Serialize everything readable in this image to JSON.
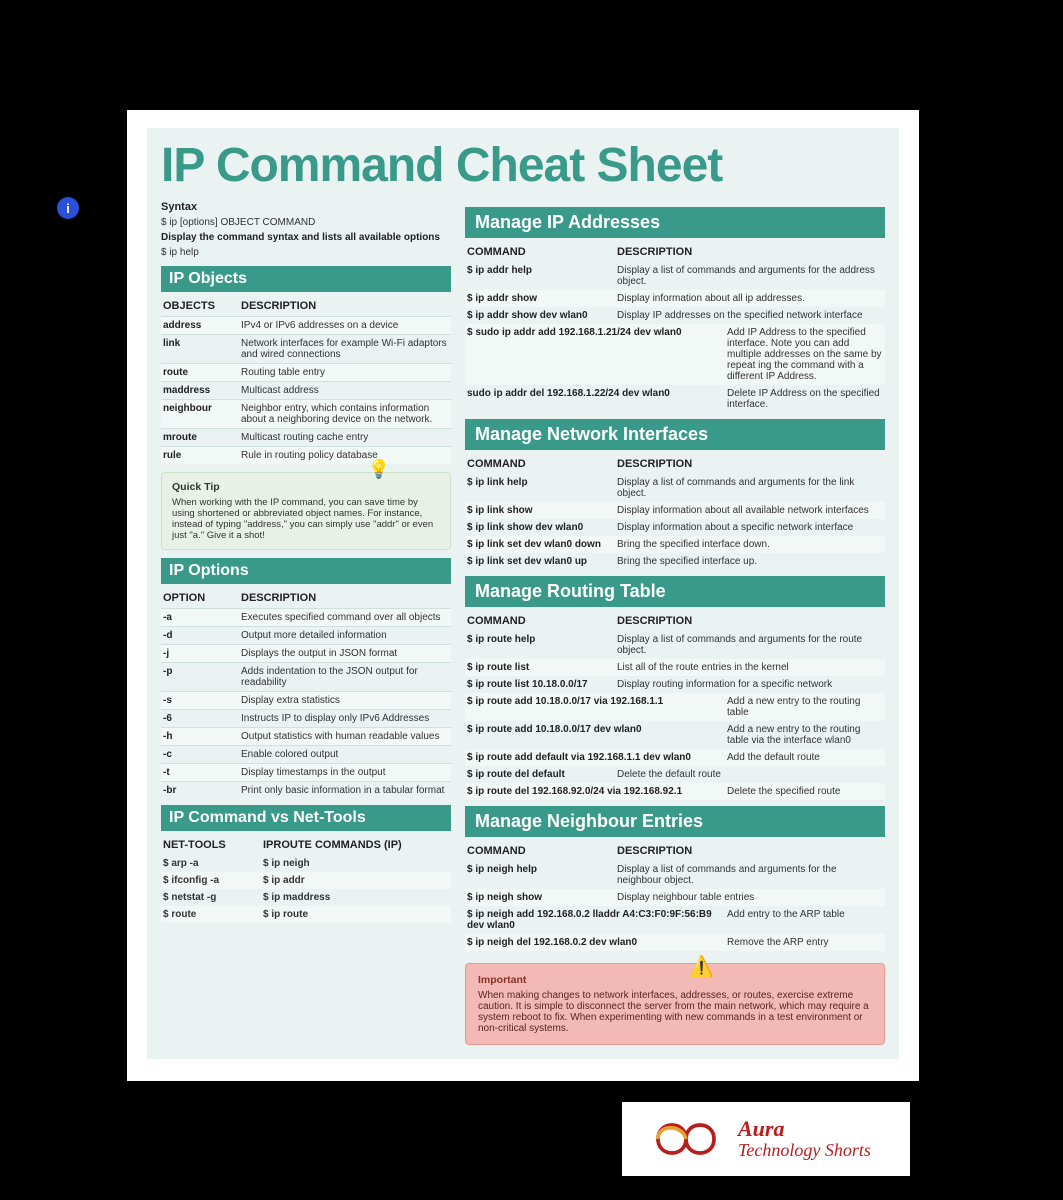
{
  "title": "IP Command Cheat Sheet",
  "info_icon": "i",
  "syntax": {
    "label": "Syntax",
    "cmd": "$ ip [options] OBJECT COMMAND",
    "desc": "Display the command syntax and lists all available options",
    "help": "$ ip help"
  },
  "objects": {
    "title": "IP Objects",
    "col1": "OBJECTS",
    "col2": "DESCRIPTION",
    "rows": [
      {
        "k": "address",
        "v": "IPv4 or IPv6 addresses on a device"
      },
      {
        "k": "link",
        "v": "Network interfaces for example Wi-Fi adaptors and wired connections"
      },
      {
        "k": "route",
        "v": "Routing table entry"
      },
      {
        "k": "maddress",
        "v": "Multicast address"
      },
      {
        "k": "neighbour",
        "v": "Neighbor entry, which contains information about a neighboring device on the network."
      },
      {
        "k": "mroute",
        "v": "Multicast routing cache entry"
      },
      {
        "k": "rule",
        "v": "Rule in routing policy database"
      }
    ]
  },
  "tip": {
    "title": "Quick Tip",
    "body": "When working with the IP command, you can save time by using shortened or abbreviated object names. For instance, instead of typing \"address,\" you can simply use \"addr\" or even just \"a.\"  Give it a shot!"
  },
  "options": {
    "title": "IP Options",
    "col1": "OPTION",
    "col2": "DESCRIPTION",
    "rows": [
      {
        "k": "-a",
        "v": "Executes specified command over all objects"
      },
      {
        "k": "-d",
        "v": "Output more detailed information"
      },
      {
        "k": "-j",
        "v": "Displays the output in JSON format"
      },
      {
        "k": "-p",
        "v": "Adds indentation to the JSON output for readability"
      },
      {
        "k": "-s",
        "v": "Display extra statistics"
      },
      {
        "k": "-6",
        "v": "Instructs IP to display only IPv6 Addresses"
      },
      {
        "k": "-h",
        "v": "Output statistics with human readable values"
      },
      {
        "k": "-c",
        "v": "Enable colored output"
      },
      {
        "k": "-t",
        "v": "Display timestamps in the output"
      },
      {
        "k": "-br",
        "v": "Print only basic information in a tabular format"
      }
    ]
  },
  "nettools": {
    "title": "IP Command vs Net-Tools",
    "col1": "NET-TOOLS",
    "col2": "IPROUTE COMMANDS (IP)",
    "rows": [
      {
        "k": "$ arp -a",
        "v": "$ ip neigh"
      },
      {
        "k": "$ ifconfig -a",
        "v": "$ ip addr"
      },
      {
        "k": "$ netstat -g",
        "v": "$ ip maddress"
      },
      {
        "k": "$ route",
        "v": "$ ip route"
      }
    ]
  },
  "addr": {
    "title": "Manage IP Addresses",
    "col1": "COMMAND",
    "col2": "DESCRIPTION",
    "rows": [
      {
        "k": "$ ip addr help",
        "v": "Display a list of commands and arguments  for the address object."
      },
      {
        "k": "$ ip addr show",
        "v": "Display information about all ip addresses."
      },
      {
        "k": "$ ip addr show dev wlan0",
        "v": "Display IP addresses on the specified network interface"
      },
      {
        "k": "$ sudo ip addr add 192.168.1.21/24 dev wlan0",
        "v": "Add IP Address to the specified interface. Note you can add multiple addresses on the same by repeat ing the command with a different IP Address.",
        "wide": true
      },
      {
        "k": "sudo ip addr del 192.168.1.22/24 dev wlan0",
        "v": "Delete IP Address on the specified interface.",
        "wide": true
      }
    ]
  },
  "iface": {
    "title": "Manage Network Interfaces",
    "col1": "COMMAND",
    "col2": "DESCRIPTION",
    "rows": [
      {
        "k": "$ ip link help",
        "v": "Display a list of commands and arguments  for the link object."
      },
      {
        "k": "$ ip link show",
        "v": "Display information about all available network interfaces"
      },
      {
        "k": "$ ip link show dev wlan0",
        "v": "Display information about a specific network interface"
      },
      {
        "k": "$ ip link set dev  wlan0 down",
        "v": "Bring the specified interface down."
      },
      {
        "k": "$ ip link set dev  wlan0 up",
        "v": "Bring the specified interface up."
      }
    ]
  },
  "route": {
    "title": "Manage Routing Table",
    "col1": "COMMAND",
    "col2": "DESCRIPTION",
    "rows": [
      {
        "k": "$ ip route help",
        "v": "Display a list of commands and arguments  for the route object."
      },
      {
        "k": "$ ip route list",
        "v": "List all of the route entries in the kernel"
      },
      {
        "k": "$ ip route list 10.18.0.0/17",
        "v": "Display routing information for a specific network"
      },
      {
        "k": "$ ip route add 10.18.0.0/17 via 192.168.1.1",
        "v": "Add a new entry to the routing table",
        "wide": true
      },
      {
        "k": "$ ip route add 10.18.0.0/17 dev wlan0",
        "v": "Add a new entry to the routing table via the interface wlan0",
        "wide": true
      },
      {
        "k": "$ ip route add default via 192.168.1.1 dev wlan0",
        "v": "Add the default route",
        "wide": true
      },
      {
        "k": "$ ip route del default",
        "v": "Delete the default route"
      },
      {
        "k": "$ ip route del 192.168.92.0/24 via 192.168.92.1",
        "v": "Delete the specified route",
        "wide": true
      }
    ]
  },
  "neigh": {
    "title": "Manage Neighbour Entries",
    "col1": "COMMAND",
    "col2": "DESCRIPTION",
    "rows": [
      {
        "k": "$ ip neigh help",
        "v": "Display a list of commands and arguments  for the neighbour object."
      },
      {
        "k": "$ ip neigh show",
        "v": "Display neighbour table entries"
      },
      {
        "k": "$ ip neigh add 192.168.0.2 lladdr A4:C3:F0:9F:56:B9 dev wlan0",
        "v": "Add entry to the ARP table",
        "wide": true
      },
      {
        "k": "$ ip neigh del 192.168.0.2 dev wlan0",
        "v": "Remove the ARP entry",
        "wide": true
      }
    ]
  },
  "warn": {
    "title": "Important",
    "body": "When making changes to network interfaces, addresses, or routes, exercise extreme caution. It is simple to disconnect the server from the main network, which may require a system reboot to fix. When experimenting with new commands in a test environment or non-critical systems."
  },
  "logo": {
    "line1": "Aura",
    "line2": "Technology Shorts"
  }
}
